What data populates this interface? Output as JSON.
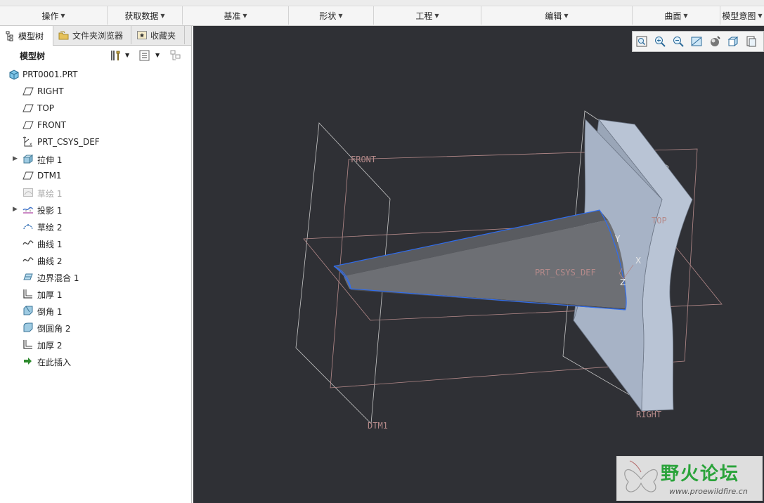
{
  "ribbon": {
    "groups": [
      {
        "label": "操作"
      },
      {
        "label": "获取数据"
      },
      {
        "label": "基准"
      },
      {
        "label": "形状"
      },
      {
        "label": "工程"
      },
      {
        "label": "编辑"
      },
      {
        "label": "曲面"
      },
      {
        "label": "模型意图"
      }
    ]
  },
  "left_panel": {
    "tabs": [
      {
        "label": "模型树",
        "icon": "model-tree-icon"
      },
      {
        "label": "文件夹浏览器",
        "icon": "folder-icon"
      },
      {
        "label": "收藏夹",
        "icon": "favorites-icon"
      }
    ],
    "header_label": "模型树",
    "tree": [
      {
        "label": "PRT0001.PRT",
        "icon": "part-icon"
      },
      {
        "label": "RIGHT",
        "icon": "datum-plane-icon"
      },
      {
        "label": "TOP",
        "icon": "datum-plane-icon"
      },
      {
        "label": "FRONT",
        "icon": "datum-plane-icon"
      },
      {
        "label": "PRT_CSYS_DEF",
        "icon": "csys-icon"
      },
      {
        "label": "拉伸 1",
        "icon": "extrude-icon",
        "expandable": true
      },
      {
        "label": "DTM1",
        "icon": "datum-plane-icon"
      },
      {
        "label": "草绘 1",
        "icon": "sketch-icon",
        "suppressed": true
      },
      {
        "label": "投影 1",
        "icon": "projection-icon",
        "expandable": true
      },
      {
        "label": "草绘 2",
        "icon": "sketch-icon"
      },
      {
        "label": "曲线 1",
        "icon": "curve-icon"
      },
      {
        "label": "曲线 2",
        "icon": "curve-icon"
      },
      {
        "label": "边界混合 1",
        "icon": "boundary-blend-icon"
      },
      {
        "label": "加厚 1",
        "icon": "thicken-icon"
      },
      {
        "label": "倒角 1",
        "icon": "chamfer-icon"
      },
      {
        "label": "倒圆角 2",
        "icon": "round-icon"
      },
      {
        "label": "加厚 2",
        "icon": "thicken-icon"
      },
      {
        "label": "在此插入",
        "icon": "insert-here-arrow-icon"
      }
    ]
  },
  "viewport": {
    "datum_labels": {
      "front": "FRONT",
      "top": "TOP",
      "right": "RIGHT",
      "dtm1": "DTM1",
      "csys": "PRT_CSYS_DEF",
      "axis_x": "X",
      "axis_y": "Y",
      "axis_z": "Z"
    },
    "toolbar_icons": [
      "refit-icon",
      "zoom-in-icon",
      "zoom-out-icon",
      "repaint-icon",
      "display-style-icon",
      "saved-orientation-icon",
      "view-manager-icon"
    ]
  },
  "watermark": {
    "title": "野火论坛",
    "url": "www.proewildfire.cn"
  },
  "colors": {
    "viewport_bg": "#2f3035",
    "datum_plane": "#b58a8a",
    "datum_plane_light": "#c9c9c9",
    "selection_blue": "#2f6df0",
    "part_blue": "#a9b6c9"
  }
}
